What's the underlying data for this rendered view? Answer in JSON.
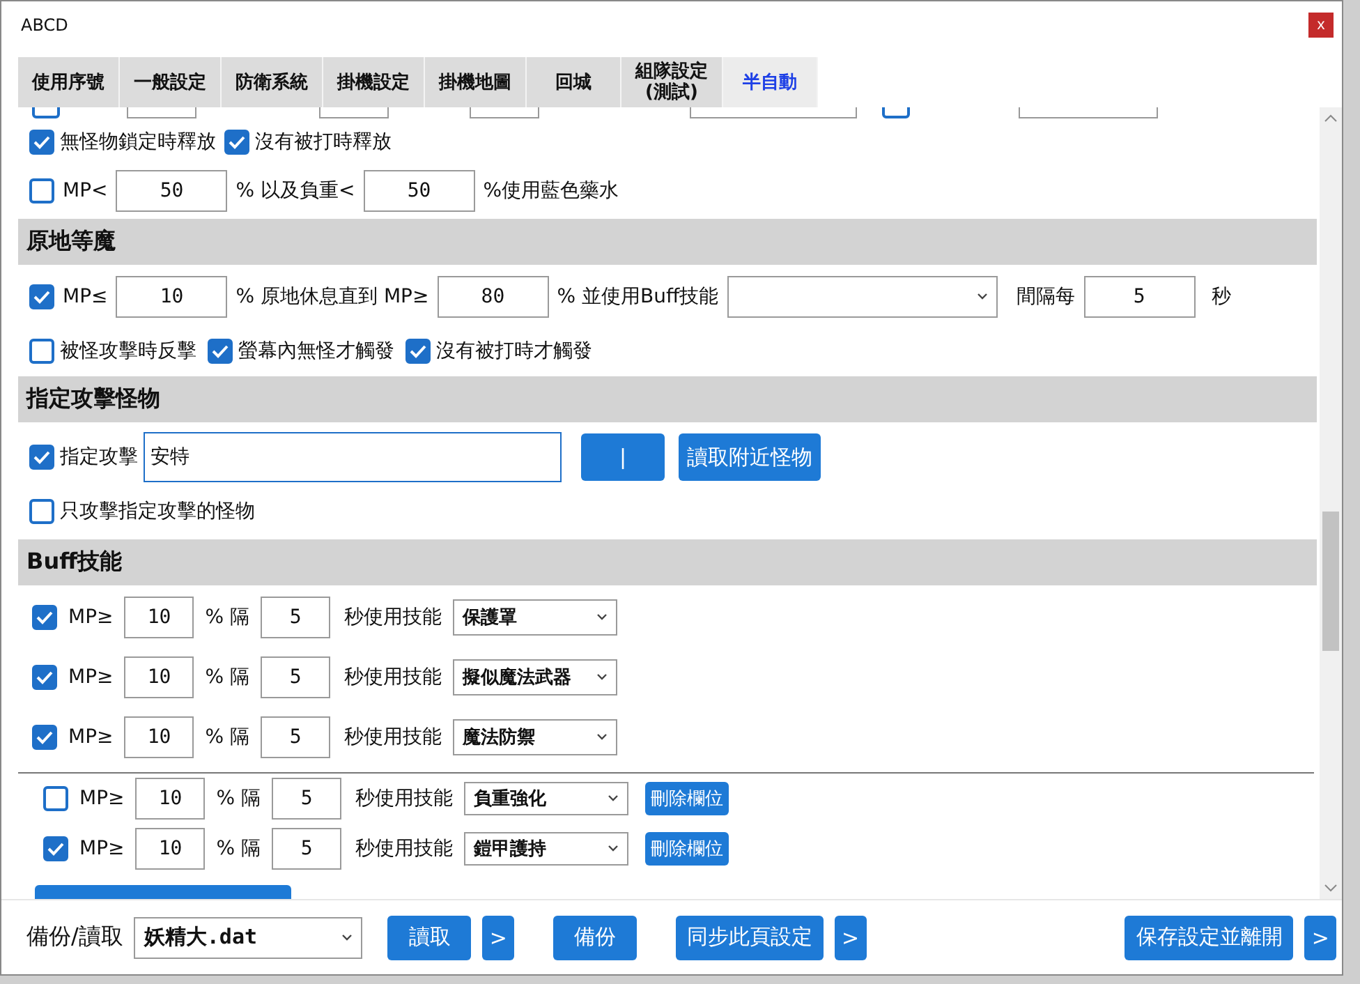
{
  "window": {
    "title": "ABCD",
    "close": "x"
  },
  "tabs": [
    {
      "label": "使用序號",
      "selected": false
    },
    {
      "label": "一般設定",
      "selected": false
    },
    {
      "label": "防衛系統",
      "selected": false
    },
    {
      "label": "掛機設定",
      "selected": false
    },
    {
      "label": "掛機地圖",
      "selected": false
    },
    {
      "label": "回城",
      "selected": false
    },
    {
      "label": "組隊設定",
      "sublabel": "(測試)",
      "selected": false
    },
    {
      "label": "半自動",
      "selected": true
    }
  ],
  "cut_row": {
    "checkboxes": [
      {
        "checked": false
      },
      {
        "checked": false
      }
    ]
  },
  "release_options": [
    {
      "label": "無怪物鎖定時釋放",
      "checked": true
    },
    {
      "label": "沒有被打時釋放",
      "checked": true
    }
  ],
  "blue_potion": {
    "checked": false,
    "mp_label": "MP<",
    "mp_value": "50",
    "weight_label": "% 以及負重<",
    "weight_value": "50",
    "suffix": "%使用藍色藥水"
  },
  "rest_section": {
    "title": "原地等魔",
    "checked": true,
    "mp_label": "MP≤",
    "mp_value": "10",
    "until_label": "% 原地休息直到 MP≥",
    "until_value": "80",
    "buff_label": "% 並使用Buff技能",
    "interval_label": "間隔每",
    "interval_value": "5",
    "seconds_label": "秒",
    "options": [
      {
        "label": "被怪攻擊時反擊",
        "checked": false
      },
      {
        "label": "螢幕內無怪才觸發",
        "checked": true
      },
      {
        "label": "沒有被打時才觸發",
        "checked": true
      }
    ]
  },
  "target_section": {
    "title": "指定攻擊怪物",
    "checked": true,
    "label": "指定攻擊",
    "value": "安特",
    "separator_button": "|",
    "read_button": "讀取附近怪物",
    "only_option": {
      "label": "只攻擊指定攻擊的怪物",
      "checked": false
    }
  },
  "buff_section": {
    "title": "Buff技能",
    "rows": [
      {
        "kind": "fixed",
        "checked": true,
        "mp_label": "MP≥",
        "mp_value": "10",
        "interval_label": "% 隔",
        "interval_value": "5",
        "skill_label": "秒使用技能",
        "skill": "保護罩"
      },
      {
        "kind": "fixed",
        "checked": true,
        "mp_label": "MP≥",
        "mp_value": "10",
        "interval_label": "% 隔",
        "interval_value": "5",
        "skill_label": "秒使用技能",
        "skill": "擬似魔法武器"
      },
      {
        "kind": "fixed",
        "checked": true,
        "mp_label": "MP≥",
        "mp_value": "10",
        "interval_label": "% 隔",
        "interval_value": "5",
        "skill_label": "秒使用技能",
        "skill": "魔法防禦"
      },
      {
        "kind": "custom",
        "checked": false,
        "mp_label": "MP≥",
        "mp_value": "10",
        "interval_label": "% 隔",
        "interval_value": "5",
        "skill_label": "秒使用技能",
        "skill": "負重強化",
        "delete_button": "刪除欄位"
      },
      {
        "kind": "custom",
        "checked": true,
        "mp_label": "MP≥",
        "mp_value": "10",
        "interval_label": "% 隔",
        "interval_value": "5",
        "skill_label": "秒使用技能",
        "skill": "鎧甲護持",
        "delete_button": "刪除欄位"
      }
    ]
  },
  "footer": {
    "label": "備份/讀取",
    "file": "妖精大.dat",
    "buttons": [
      {
        "kind": "main",
        "label": "讀取"
      },
      {
        "kind": "more",
        "label": ">"
      },
      {
        "kind": "main",
        "label": "備份"
      },
      {
        "kind": "main",
        "label": "同步此頁設定"
      },
      {
        "kind": "more",
        "label": ">"
      }
    ],
    "right_buttons": [
      {
        "kind": "main",
        "label": "保存設定並離開"
      },
      {
        "kind": "more",
        "label": ">"
      }
    ]
  }
}
